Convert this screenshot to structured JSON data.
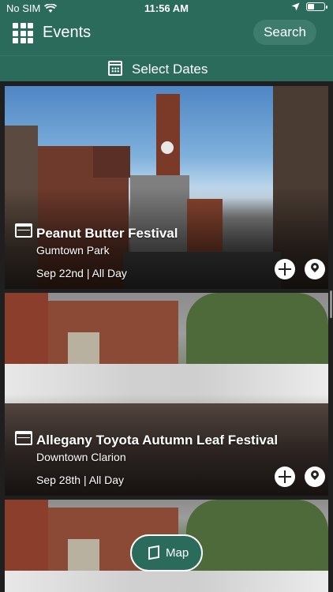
{
  "status": {
    "carrier": "No SIM",
    "time": "11:56 AM",
    "battery_level": 0.35
  },
  "header": {
    "title": "Events",
    "search_label": "Search",
    "menu_icon": "grid-icon"
  },
  "date_filter": {
    "label": "Select Dates",
    "icon": "calendar-icon"
  },
  "events": [
    {
      "title": "Peanut Butter Festival",
      "venue": "Gumtown Park",
      "date": "Sep 22nd | All Day"
    },
    {
      "title": "Allegany Toyota Autumn Leaf Festival",
      "venue": "Downtown Clarion",
      "date": "Sep 28th | All Day"
    },
    {
      "title": "",
      "venue": "",
      "date": ""
    }
  ],
  "map_button": {
    "label": "Map",
    "icon": "map-icon"
  },
  "colors": {
    "brand": "#2b6b5c",
    "search_pill": "#3e7d6e",
    "white": "#ffffff"
  }
}
